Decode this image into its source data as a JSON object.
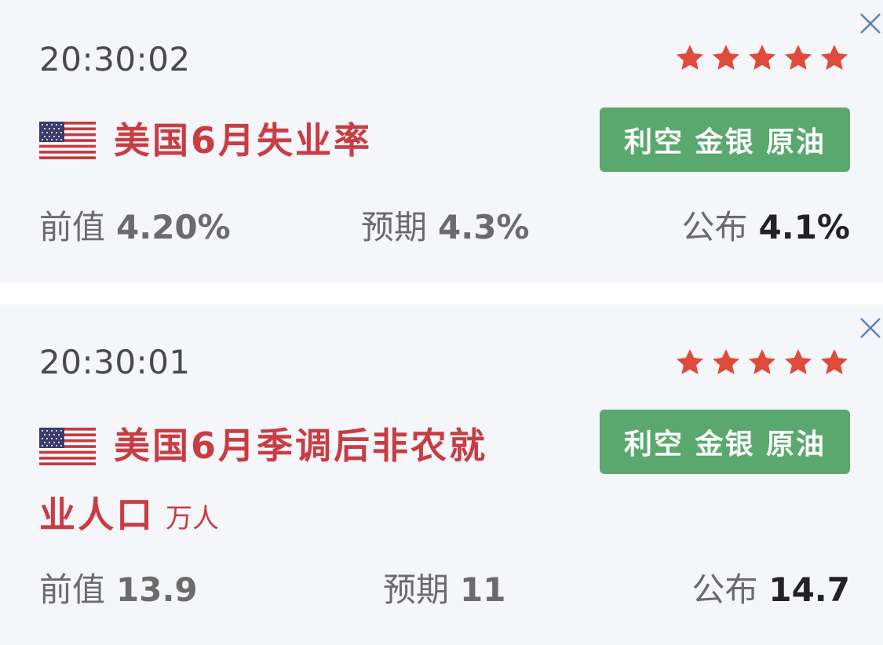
{
  "events": [
    {
      "time": "20:30:02",
      "stars": 5,
      "flag": "us-flag",
      "title_line1": "美国6月失业率",
      "title_line2": "",
      "unit": "",
      "tag": "利空 金银 原油",
      "prev_label": "前值",
      "prev_value": "4.20%",
      "expected_label": "预期",
      "expected_value": "4.3%",
      "published_label": "公布",
      "published_value": "4.1%"
    },
    {
      "time": "20:30:01",
      "stars": 5,
      "flag": "us-flag",
      "title_line1": "美国6月季调后非农就",
      "title_line2": "业人口",
      "unit": "万人",
      "tag": "利空 金银 原油",
      "prev_label": "前值",
      "prev_value": "13.9",
      "expected_label": "预期",
      "expected_value": "11",
      "published_label": "公布",
      "published_value": "14.7"
    }
  ],
  "colors": {
    "title_red": "#c83d44",
    "star_red": "#e04a3b",
    "tag_green": "#5aa86d",
    "close_blue": "#5b7fc9",
    "card_bg": "#f5f6fa"
  },
  "icons": {
    "close": "close-icon",
    "star": "star-icon",
    "flag": "us-flag-icon"
  }
}
